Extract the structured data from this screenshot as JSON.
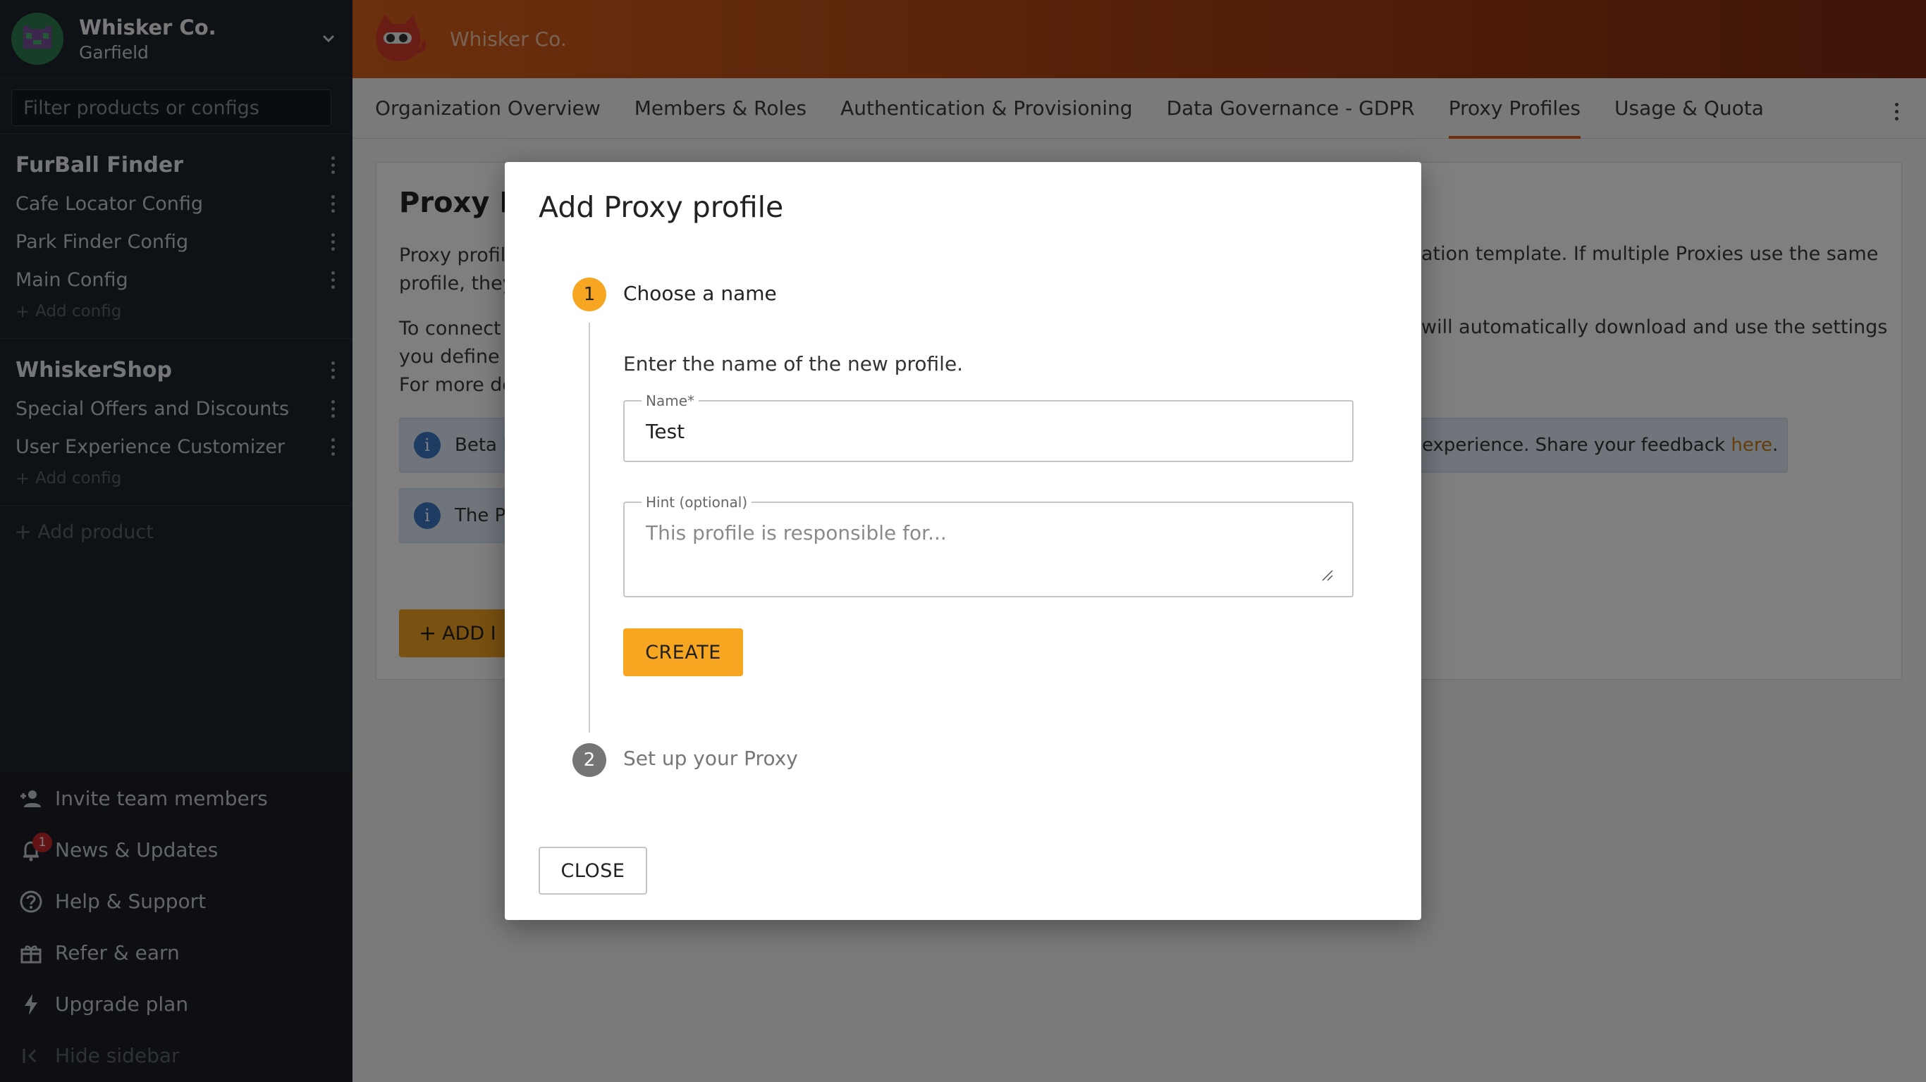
{
  "org": {
    "name": "Whisker Co.",
    "user": "Garfield"
  },
  "sidebar": {
    "filter_placeholder": "Filter products or configs",
    "products": [
      {
        "name": "FurBall Finder",
        "configs": [
          "Cafe Locator Config",
          "Park Finder Config",
          "Main Config"
        ],
        "add_config": "Add config"
      },
      {
        "name": "WhiskerShop",
        "configs": [
          "Special Offers and Discounts",
          "User Experience Customizer"
        ],
        "add_config": "Add config"
      }
    ],
    "add_product": "Add product",
    "bottom": {
      "invite": "Invite team members",
      "news": "News & Updates",
      "news_badge": "1",
      "help": "Help & Support",
      "refer": "Refer & earn",
      "upgrade": "Upgrade plan",
      "hide": "Hide sidebar"
    }
  },
  "topbar": {
    "title": "Whisker Co."
  },
  "tabs": [
    "Organization Overview",
    "Members & Roles",
    "Authentication & Provisioning",
    "Data Governance - GDPR",
    "Proxy Profiles",
    "Usage & Quota"
  ],
  "page": {
    "title_visible": "Proxy P",
    "para1_left": "Proxy profile",
    "para1_left2": "profile, they",
    "para1_right": "ation template. If multiple Proxies use the same",
    "para2_left": "To connect",
    "para2_left2": "you define h",
    "para2_left3": "For more de",
    "para2_right": "will automatically download and use the settings",
    "info1_left": "Beta F",
    "info1_right": "experience. Share your feedback ",
    "info1_link": "here",
    "info1_end": ".",
    "info2_left": "The P",
    "add_button": "ADD I"
  },
  "dialog": {
    "title": "Add Proxy profile",
    "step1_num": "1",
    "step1_label": "Choose a name",
    "step1_desc": "Enter the name of the new profile.",
    "name_label": "Name*",
    "name_value": "Test",
    "hint_label": "Hint (optional)",
    "hint_placeholder": "This profile is responsible for...",
    "create": "CREATE",
    "step2_num": "2",
    "step2_label": "Set up your Proxy",
    "close": "CLOSE"
  },
  "colors": {
    "accent": "#f7a622",
    "tab_underline": "#e25b1c",
    "sidebar_bg": "#1d232b"
  }
}
